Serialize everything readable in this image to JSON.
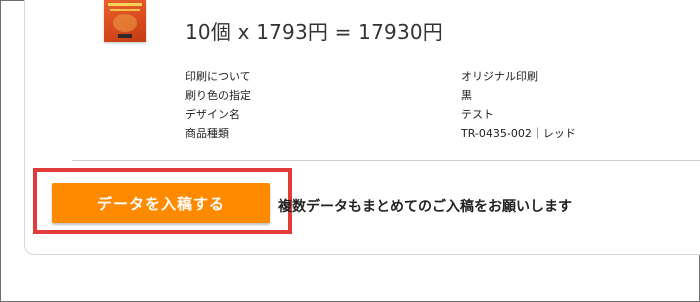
{
  "item": {
    "thumbnail_icon": "book-cover-thumbnail",
    "price_line": "10個 x 1793円 = 17930円"
  },
  "specs": [
    {
      "label": "印刷について",
      "value": "オリジナル印刷"
    },
    {
      "label": "刷り色の指定",
      "value": "黒"
    },
    {
      "label": "デザイン名",
      "value": "テスト"
    },
    {
      "label": "商品種類",
      "value": "TR-0435-002｜レッド"
    }
  ],
  "upload": {
    "button_label": "データを入稿する",
    "note": "複数データもまとめてのご入稿をお願いします"
  },
  "colors": {
    "button": "#ff8a00",
    "highlight_border": "#e23b3b",
    "thumbnail": "#d94b1e"
  }
}
